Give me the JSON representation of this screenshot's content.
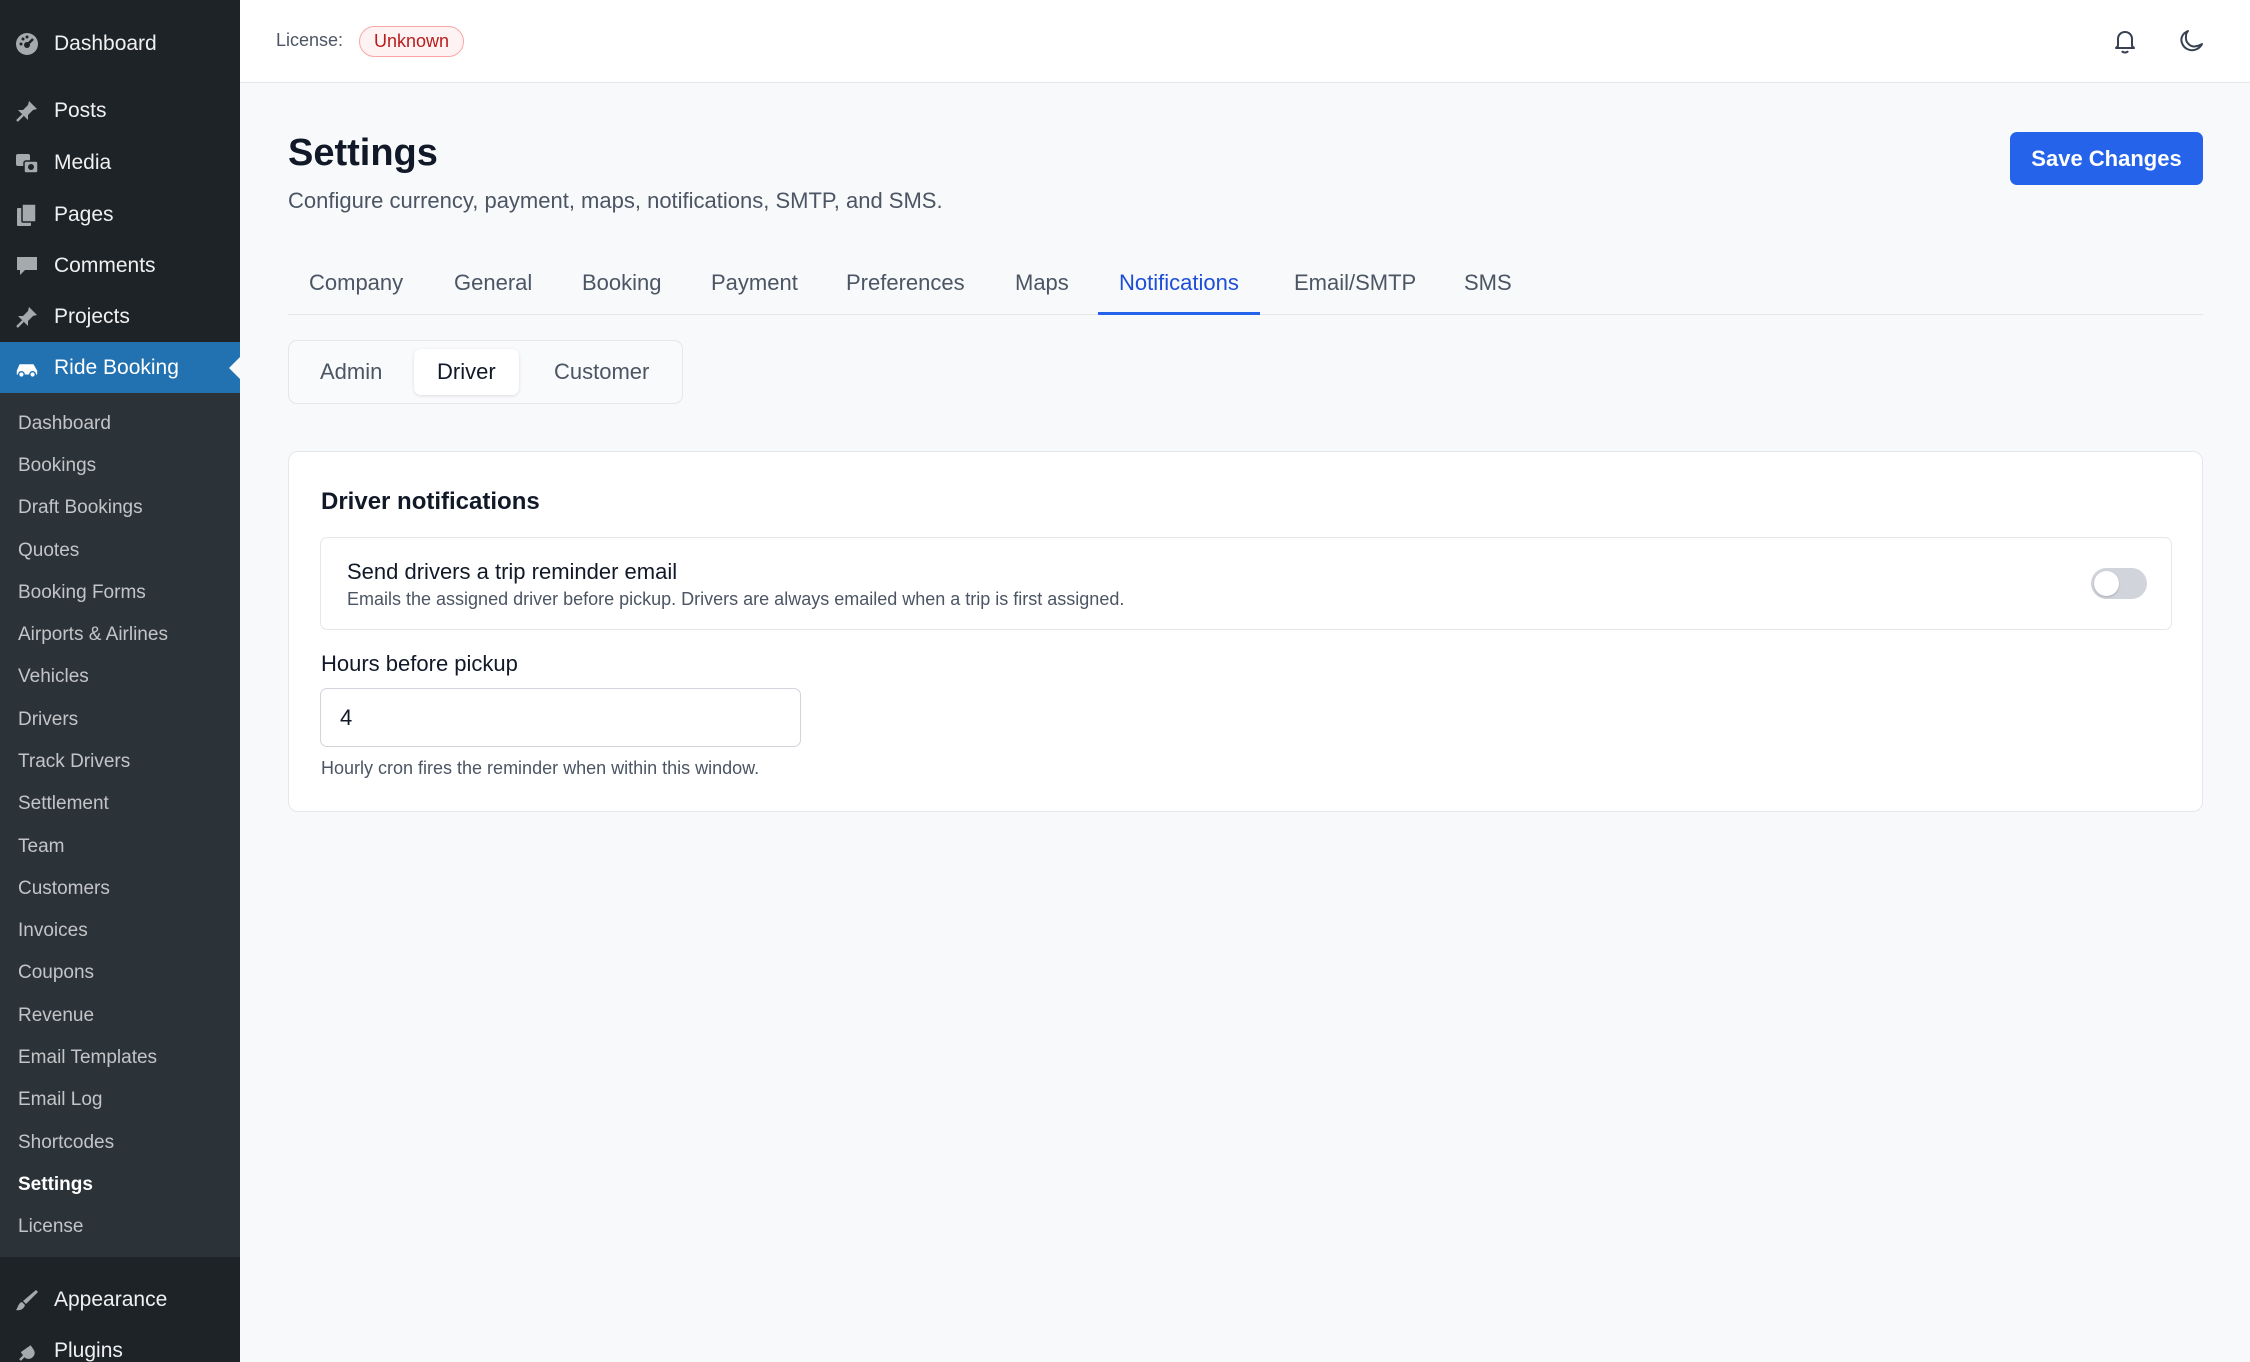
{
  "sidebar": {
    "top_items": [
      {
        "label": "Dashboard",
        "icon": "dashboard-icon"
      },
      {
        "label": "Posts",
        "icon": "pin-icon"
      },
      {
        "label": "Media",
        "icon": "media-icon"
      },
      {
        "label": "Pages",
        "icon": "pages-icon"
      },
      {
        "label": "Comments",
        "icon": "comment-icon"
      },
      {
        "label": "Projects",
        "icon": "pin-icon"
      },
      {
        "label": "Ride Booking",
        "icon": "car-icon"
      }
    ],
    "submenu": [
      "Dashboard",
      "Bookings",
      "Draft Bookings",
      "Quotes",
      "Booking Forms",
      "Airports & Airlines",
      "Vehicles",
      "Drivers",
      "Track Drivers",
      "Settlement",
      "Team",
      "Customers",
      "Invoices",
      "Coupons",
      "Revenue",
      "Email Templates",
      "Email Log",
      "Shortcodes",
      "Settings",
      "License"
    ],
    "current_submenu": "Settings",
    "bottom_items": [
      {
        "label": "Appearance",
        "icon": "brush-icon"
      },
      {
        "label": "Plugins",
        "icon": "plug-icon"
      }
    ]
  },
  "topbar": {
    "license_label": "License:",
    "license_status": "Unknown"
  },
  "page": {
    "title": "Settings",
    "subtitle": "Configure currency, payment, maps, notifications, SMTP, and SMS.",
    "save_label": "Save Changes"
  },
  "tabs": [
    "Company",
    "General",
    "Booking",
    "Payment",
    "Preferences",
    "Maps",
    "Notifications",
    "Email/SMTP",
    "SMS"
  ],
  "active_tab": "Notifications",
  "subtabs": [
    "Admin",
    "Driver",
    "Customer"
  ],
  "active_subtab": "Driver",
  "card": {
    "title": "Driver notifications",
    "toggle_title": "Send drivers a trip reminder email",
    "toggle_desc": "Emails the assigned driver before pickup. Drivers are always emailed when a trip is first assigned.",
    "toggle_on": false,
    "field_label": "Hours before pickup",
    "field_value": "4",
    "field_help": "Hourly cron fires the reminder when within this window."
  },
  "colors": {
    "accent": "#2563eb",
    "sidebar_bg": "#1d2327",
    "sidebar_active": "#2271b1",
    "badge_red": "#b91c1c"
  }
}
